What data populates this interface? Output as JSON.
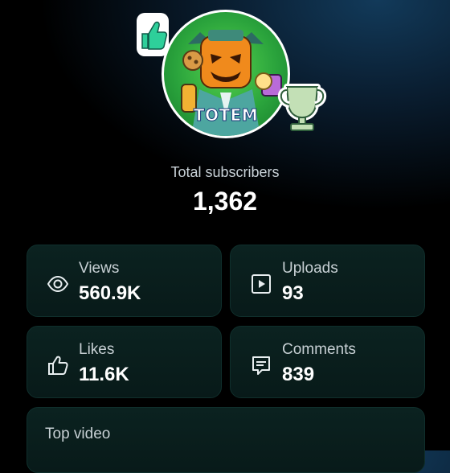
{
  "channel": {
    "avatar_label": "TOTEM",
    "subscribers_label": "Total subscribers",
    "subscribers_count": "1,362"
  },
  "stats": {
    "views": {
      "label": "Views",
      "value": "560.9K"
    },
    "uploads": {
      "label": "Uploads",
      "value": "93"
    },
    "likes": {
      "label": "Likes",
      "value": "11.6K"
    },
    "comments": {
      "label": "Comments",
      "value": "839"
    }
  },
  "top_video": {
    "label": "Top video"
  },
  "colors": {
    "accent_green": "#2ecf9a",
    "card_bg": "#0b2220",
    "text_muted": "#c7d0d4"
  },
  "icons": [
    "thumbs-up-sticker-icon",
    "trophy-sticker-icon",
    "eye-icon",
    "play-icon",
    "thumbs-up-icon",
    "comment-icon"
  ]
}
